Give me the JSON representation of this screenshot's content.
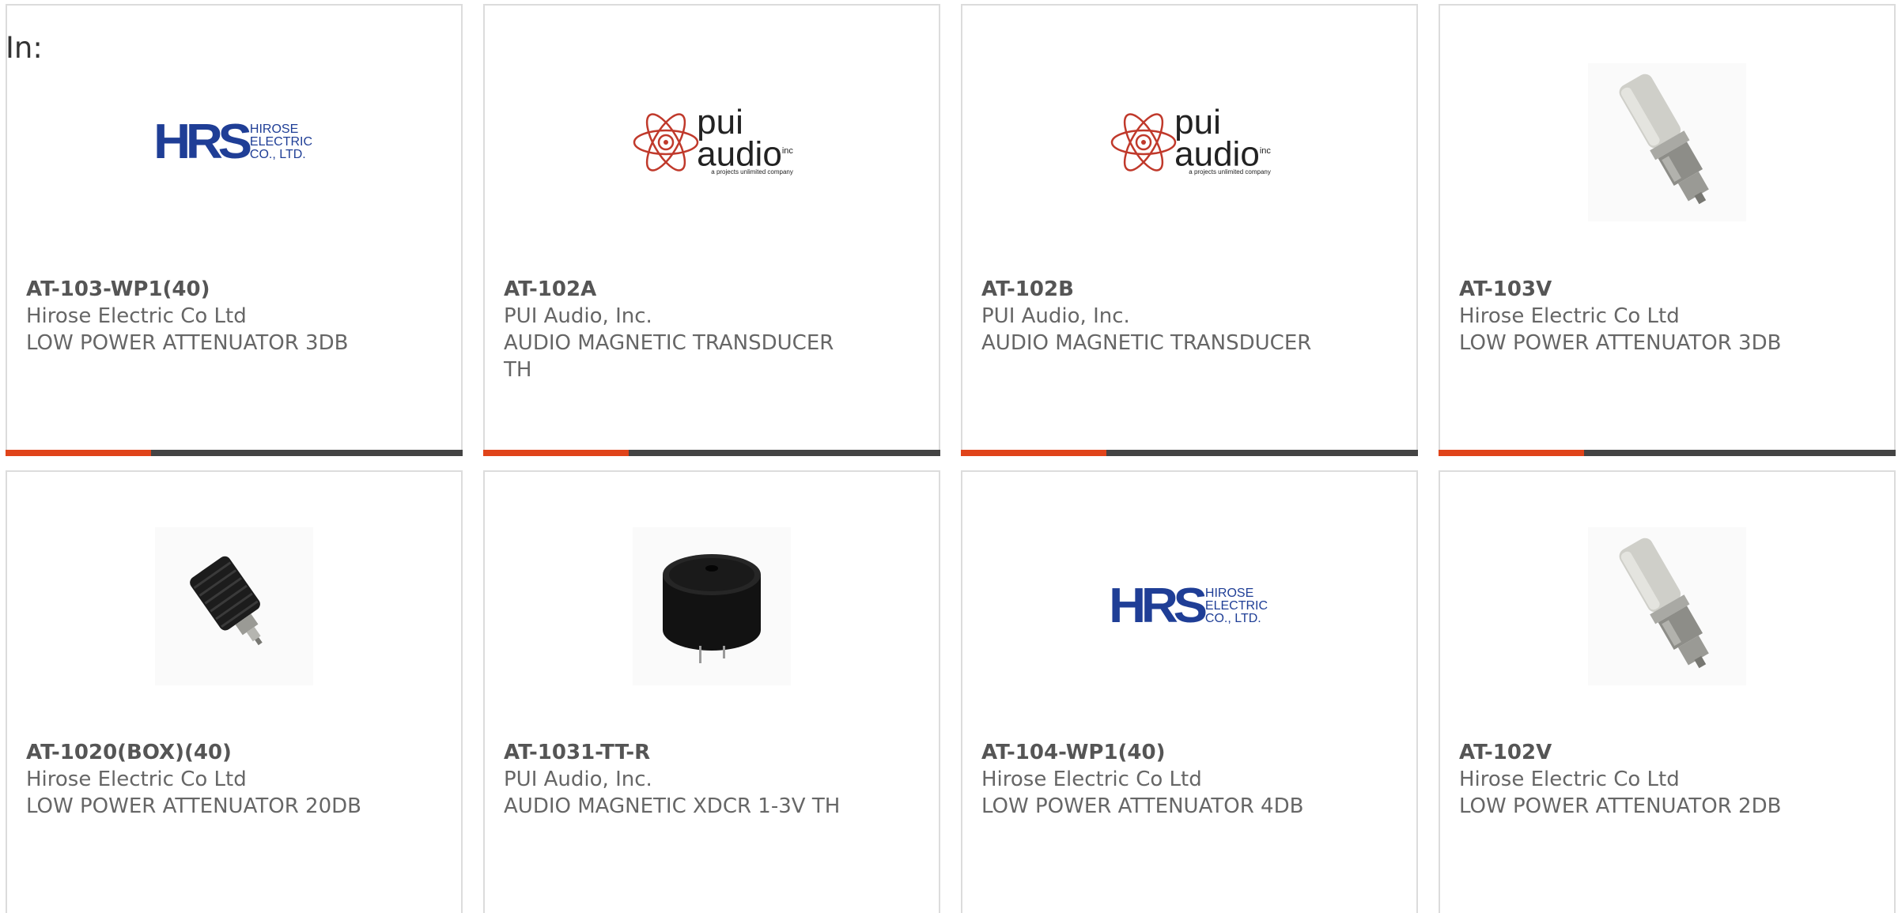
{
  "header": {
    "in_label": "In:"
  },
  "products": [
    {
      "part_number": "AT-103-WP1(40)",
      "manufacturer": "Hirose Electric Co Ltd",
      "description": "LOW POWER ATTENUATOR 3DB",
      "image": "hirose-logo"
    },
    {
      "part_number": "AT-102A",
      "manufacturer": "PUI Audio, Inc.",
      "description": "AUDIO MAGNETIC TRANSDUCER TH",
      "image": "pui-audio-logo"
    },
    {
      "part_number": "AT-102B",
      "manufacturer": "PUI Audio, Inc.",
      "description": "AUDIO MAGNETIC TRANSDUCER",
      "image": "pui-audio-logo"
    },
    {
      "part_number": "AT-103V",
      "manufacturer": "Hirose Electric Co Ltd",
      "description": "LOW POWER ATTENUATOR 3DB",
      "image": "attenuator-photo"
    },
    {
      "part_number": "AT-1020(BOX)(40)",
      "manufacturer": "Hirose Electric Co Ltd",
      "description": "LOW POWER ATTENUATOR 20DB",
      "image": "finned-attenuator-photo"
    },
    {
      "part_number": "AT-1031-TT-R",
      "manufacturer": "PUI Audio, Inc.",
      "description": "AUDIO MAGNETIC XDCR 1-3V TH",
      "image": "transducer-photo"
    },
    {
      "part_number": "AT-104-WP1(40)",
      "manufacturer": "Hirose Electric Co Ltd",
      "description": "LOW POWER ATTENUATOR 4DB",
      "image": "hirose-logo"
    },
    {
      "part_number": "AT-102V",
      "manufacturer": "Hirose Electric Co Ltd",
      "description": "LOW POWER ATTENUATOR 2DB",
      "image": "attenuator-photo"
    }
  ],
  "logos": {
    "hirose": {
      "mark": "HRS",
      "line1": "HIROSE",
      "line2": "ELECTRIC",
      "line3": "CO., LTD."
    },
    "pui": {
      "word1": "pui",
      "word2": "audio",
      "suffix": "inc",
      "tagline": "a projects unlimited company"
    }
  },
  "colors": {
    "accent": "#e0441a",
    "accent_track": "#444444",
    "hirose_blue": "#1f3e96",
    "pui_red": "#c0392b"
  }
}
